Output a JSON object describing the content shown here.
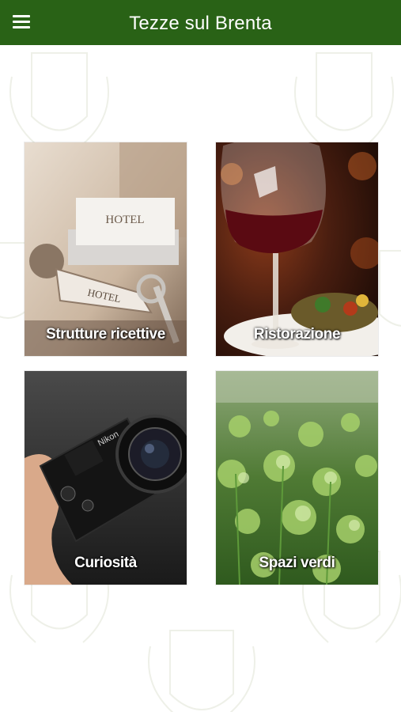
{
  "header": {
    "title": "Tezze sul Brenta",
    "menu_icon": "hamburger-menu-icon",
    "bar_color": "#296216"
  },
  "tiles": [
    {
      "label": "Strutture ricettive",
      "image": "hotel-key-photo"
    },
    {
      "label": "Ristorazione",
      "image": "wine-glass-photo"
    },
    {
      "label": "Curiosità",
      "image": "camera-photo"
    },
    {
      "label": "Spazi verdi",
      "image": "green-plants-photo"
    }
  ]
}
